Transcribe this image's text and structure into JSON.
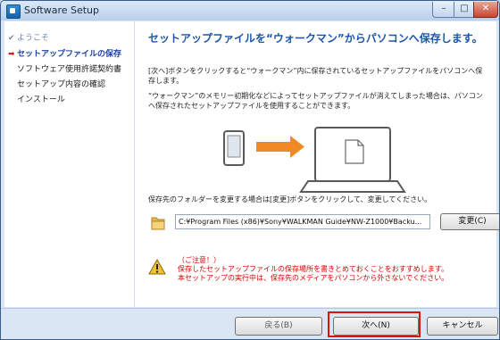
{
  "window": {
    "title": "Software Setup",
    "controls": {
      "minimize": "–",
      "maximize": "□",
      "close": "✕"
    }
  },
  "sidebar": {
    "steps": [
      {
        "mark": "✔",
        "label": "ようこそ",
        "state": "done"
      },
      {
        "mark": "➡",
        "label": "セットアップファイルの保存",
        "state": "current"
      },
      {
        "mark": "",
        "label": "ソフトウェア使用許諾契約書",
        "state": "pending"
      },
      {
        "mark": "",
        "label": "セットアップ内容の確認",
        "state": "pending"
      },
      {
        "mark": "",
        "label": "インストール",
        "state": "pending"
      }
    ]
  },
  "main": {
    "heading": "セットアップファイルを“ウォークマン”からパソコンへ保存します。",
    "paragraph1": "[次へ]ボタンをクリックすると“ウォークマン”内に保存されているセットアップファイルをパソコンへ保存します。",
    "paragraph2": "“ウォークマン”のメモリー初期化などによってセットアップファイルが消えてしまった場合は、パソコンへ保存されたセットアップファイルを使用することができます。",
    "folder_instruction": "保存先のフォルダーを変更する場合は[変更]ボタンをクリックして、変更してください。",
    "path_value": "C:¥Program Files (x86)¥Sony¥WALKMAN Guide¥NW-Z1000¥Backu...",
    "change_button": "変更(C)",
    "warning_title": "（ご注意！）",
    "warning_line1": "保存したセットアップファイルの保存場所を書きとめておくことをおすすめします。",
    "warning_line2": "本セットアップの実行中は、保存先のメディアをパソコンから外さないでください。"
  },
  "footer": {
    "back_label": "戻る(B)",
    "next_label": "次へ(N)",
    "cancel_label": "キャンセル"
  },
  "colors": {
    "heading": "#1a55b0",
    "warning": "#d40000",
    "arrow": "#f08a24",
    "highlight": "#e01010"
  }
}
